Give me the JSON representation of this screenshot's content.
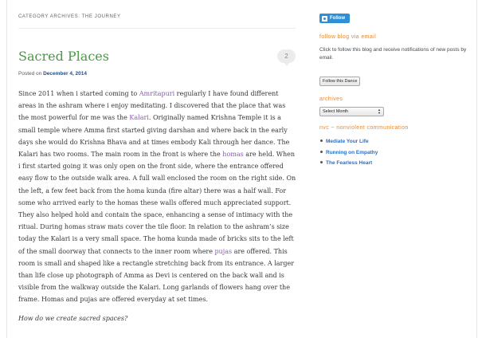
{
  "category": {
    "prefix": "Category Archives:",
    "term": "The Journey"
  },
  "post": {
    "title": "Sacred Places",
    "comment_count": "2",
    "posted_on_label": "Posted on",
    "date": "December 4, 2014",
    "paragraph1": [
      {
        "t": "Since 2011 when i started coming to "
      },
      {
        "t": "Amritapuri",
        "link": true
      },
      {
        "t": " regularly I have found different areas in the ashram where i enjoy meditating. I discovered that the place that was the most powerful for me was the "
      },
      {
        "t": "Kalari",
        "link": true
      },
      {
        "t": ". Originally named Krishna Temple it is a small temple where Amma first started giving darshan and where back in the early days she would do Krishna Bhava and at times embody Kali through her dance. The Kalari has two rooms. The main room in the front is where the "
      },
      {
        "t": "homas",
        "link": true
      },
      {
        "t": " are held. When i first started going it was only open on the front side, where the entrance offered easy flow to the outside walk area. A full wall enclosed the room on the right side. On the left, a few feet back from the homa kunda (fire altar) there was a half wall. For some who arrived early to the homas these walls offered much appreciated support. They also helped hold and contain the space, enhancing a sense of intimacy with the ritual. During homas straw mats cover the tile floor. In relation to the ashram’s size today the Kalari is a very small space. The homa kunda made of bricks sits to the left of the small doorway that connects to the inner room where "
      },
      {
        "t": "pujas",
        "link": true
      },
      {
        "t": " are offered. This room is small and shaped like a rectangle stretching back from its entrance. A larger than life close up photograph of Amma as Devi is centered on the back wall and is visible from the walkway outside the Kalari. Long garlands of flowers hang over the frame. Homas and pujas are offered everyday at set times."
      }
    ],
    "question": "How do we create sacred spaces?"
  },
  "sidebar": {
    "follow_button": "Follow",
    "follow_email_title": "follow blog via email",
    "follow_email_text": "Click to follow this blog and receive notifications of new posts by email.",
    "follow_email_button": "Follow this Dance",
    "archives_title": "archives",
    "archives_select": "Select Month",
    "nvc_title": "nvc ~ nonviolent communication",
    "nvc_items": [
      "Mediate Your Life",
      "Running on Empathy",
      "The Fearless Heart"
    ]
  },
  "colors": {
    "title_green": "#4a9a45",
    "widget_orange": "#e8892e",
    "link_blue": "#2c6fbf",
    "link_purple": "#8a5ab8",
    "follow_blue": "#2d8fd7"
  }
}
